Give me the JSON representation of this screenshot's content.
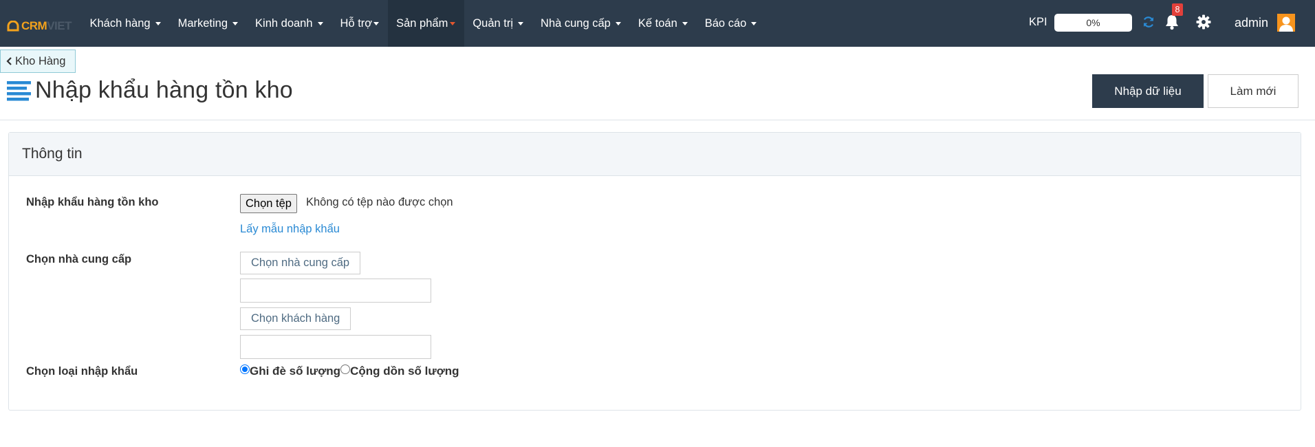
{
  "brand": {
    "crm": "CRM",
    "viet": "VIET"
  },
  "nav": [
    {
      "label": "Khách hàng",
      "active": false
    },
    {
      "label": "Marketing",
      "active": false
    },
    {
      "label": "Kinh doanh",
      "active": false
    },
    {
      "label": "Hỗ trợ",
      "active": false
    },
    {
      "label": "Sản phẩm",
      "active": true
    },
    {
      "label": "Quản trị",
      "active": false
    },
    {
      "label": "Nhà cung cấp",
      "active": false
    },
    {
      "label": "Kế toán",
      "active": false
    },
    {
      "label": "Báo cáo",
      "active": false
    }
  ],
  "kpi": {
    "label": "KPI",
    "value": "0%"
  },
  "notifications": {
    "count": "8"
  },
  "user": {
    "name": "admin"
  },
  "breadcrumb": {
    "back_label": "Kho Hàng"
  },
  "page": {
    "title": "Nhập khẩu hàng tồn kho",
    "import_button": "Nhập dữ liệu",
    "refresh_button": "Làm mới"
  },
  "panel": {
    "title": "Thông tin",
    "import_label": "Nhập khẩu hàng tồn kho",
    "file_button": "Chọn tệp",
    "file_status": "Không có tệp nào được chọn",
    "sample_link": "Lấy mẫu nhập khẩu",
    "supplier_label": "Chọn nhà cung cấp",
    "supplier_button": "Chọn nhà cung cấp",
    "supplier_value": "",
    "customer_button": "Chọn khách hàng",
    "customer_value": "",
    "import_type_label": "Chọn loại nhập khẩu",
    "import_type_options": [
      {
        "label": "Ghi đè số lượng",
        "checked": true
      },
      {
        "label": "Cộng dồn số lượng",
        "checked": false
      }
    ]
  },
  "colors": {
    "topbar": "#2d3c4c",
    "accent": "#f3a21c",
    "link": "#2a8ad4",
    "primary_button": "#2d3c4c"
  }
}
